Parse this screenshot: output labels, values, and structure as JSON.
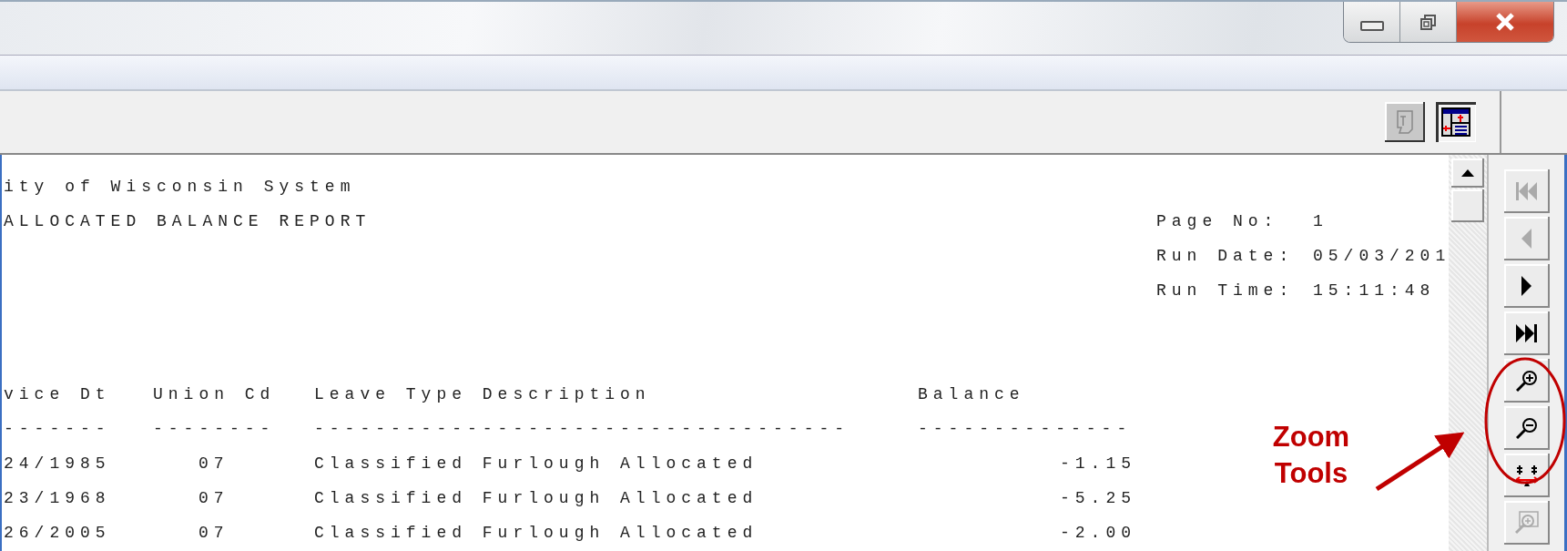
{
  "toolbar": {
    "buttons": [
      {
        "kind": "notes",
        "disabled": true
      },
      {
        "kind": "layout",
        "disabled": false
      }
    ]
  },
  "report": {
    "title_lines": [
      "ity of Wisconsin System",
      "ALLOCATED BALANCE REPORT"
    ],
    "info": [
      {
        "label": "Page No:",
        "value": "1"
      },
      {
        "label": "Run Date:",
        "value": "05/03/201"
      },
      {
        "label": "Run Time:",
        "value": "15:11:48"
      }
    ],
    "columns": [
      "vice Dt",
      "Union Cd",
      "Leave Type Description",
      "Balance"
    ],
    "rules": [
      "-------",
      "--------",
      "-----------------------------------",
      "--------------"
    ],
    "rows": [
      {
        "service_dt": "24/1985",
        "union_cd": "07",
        "description": "Classified Furlough Allocated",
        "balance": "-1.15"
      },
      {
        "service_dt": "23/1968",
        "union_cd": "07",
        "description": "Classified Furlough Allocated",
        "balance": "-5.25"
      },
      {
        "service_dt": "26/2005",
        "union_cd": "07",
        "description": "Classified Furlough Allocated",
        "balance": "-2.00"
      }
    ]
  },
  "nav": {
    "buttons": [
      {
        "kind": "first",
        "disabled": true
      },
      {
        "kind": "previous",
        "disabled": true
      },
      {
        "kind": "next",
        "disabled": false
      },
      {
        "kind": "last",
        "disabled": false
      },
      {
        "kind": "zoom_in",
        "disabled": false
      },
      {
        "kind": "zoom_out",
        "disabled": false
      },
      {
        "kind": "fit_width",
        "disabled": false
      },
      {
        "kind": "zoom_box",
        "disabled": true
      }
    ]
  },
  "annotation": {
    "text": "Zoom Tools"
  }
}
